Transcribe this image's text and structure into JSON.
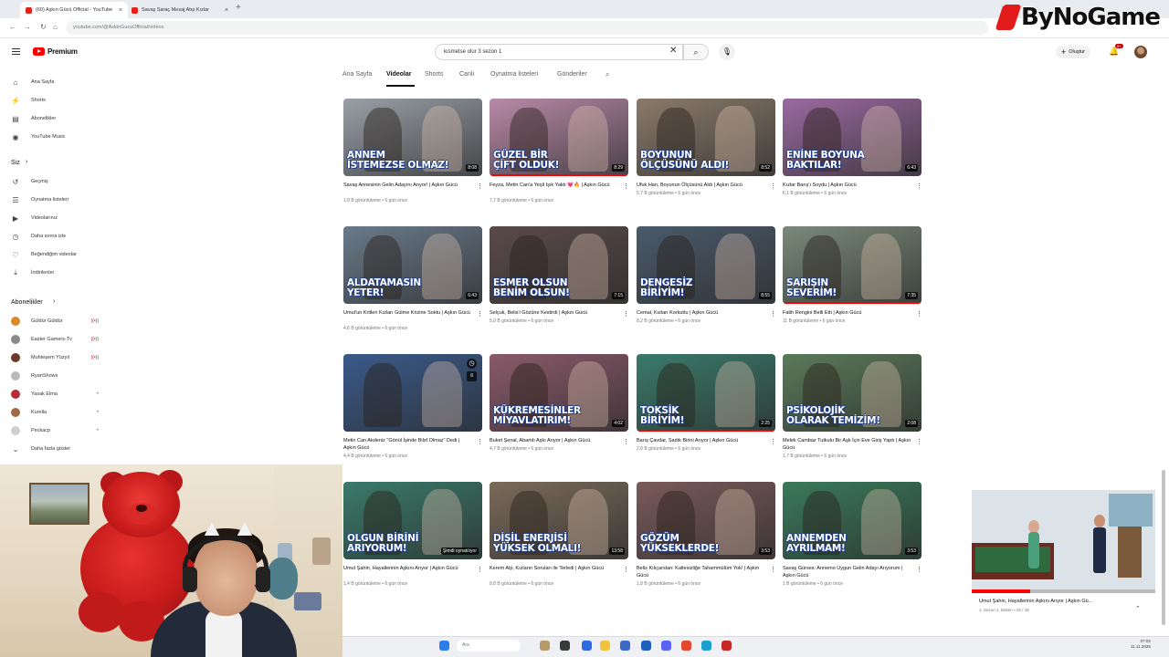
{
  "browser": {
    "tabs": [
      {
        "label": "(60) Aşkın Gücü Official - YouTube"
      },
      {
        "label": "Savaş Saraç Mesaj Atıp Kızlar"
      }
    ],
    "url": "youtube.com/@AskinGucuOfficial/videos"
  },
  "watermark": {
    "text": "ByNoGame"
  },
  "header": {
    "logo_text": "Premium",
    "search_value": "kısmetse olur 3 sezon 1",
    "create_label": "Oluştur",
    "notif_badge": "9+"
  },
  "sidebar": {
    "main": [
      {
        "label": "Ana Sayfa",
        "icon": "home-icon",
        "glyph": "⌂"
      },
      {
        "label": "Shorts",
        "icon": "shorts-icon",
        "glyph": "⚡"
      },
      {
        "label": "Abonelikler",
        "icon": "subscriptions-icon",
        "glyph": "▤"
      },
      {
        "label": "YouTube Music",
        "icon": "music-icon",
        "glyph": "◉"
      }
    ],
    "you_header": "Siz",
    "you": [
      {
        "label": "Geçmiş",
        "icon": "history-icon",
        "glyph": "↺"
      },
      {
        "label": "Oynatma listeleri",
        "icon": "playlists-icon",
        "glyph": "☰"
      },
      {
        "label": "Videolarınız",
        "icon": "your-videos-icon",
        "glyph": "▶"
      },
      {
        "label": "Daha sonra izle",
        "icon": "watch-later-icon",
        "glyph": "◷"
      },
      {
        "label": "Beğendiğim videolar",
        "icon": "liked-icon",
        "glyph": "♡"
      },
      {
        "label": "İndirilenler",
        "icon": "downloads-icon",
        "glyph": "⤓"
      }
    ],
    "subs_header": "Abonelikler",
    "subscriptions": [
      {
        "label": "Güldür Güldür",
        "status": "live",
        "color": "#d88a2a"
      },
      {
        "label": "Easter Gamers-Tv",
        "status": "live",
        "color": "#8a8a8a"
      },
      {
        "label": "Muhteşem Yüzyıl",
        "status": "live",
        "color": "#6a3a2a"
      },
      {
        "label": "RyanShows",
        "status": "",
        "color": "#bbbbbb"
      },
      {
        "label": "Yasak Elma",
        "status": "dot",
        "color": "#b82a3a"
      },
      {
        "label": "Kurella",
        "status": "dot",
        "color": "#a06a4a"
      },
      {
        "label": "Peckacp",
        "status": "dot",
        "color": "#cfcfcf"
      }
    ],
    "show_more": "Daha fazla göster"
  },
  "tabs": [
    "Ana Sayfa",
    "Videolar",
    "Shorts",
    "Canlı",
    "Oynatma listeleri",
    "Gönderiler"
  ],
  "videos": [
    {
      "overlay": [
        "ANNEM",
        "İSTEMEZSE OLMAZ!"
      ],
      "duration": "8:08",
      "title": "Savaş Annesinin Gelin Adayını Arıyor! | Aşkın Gücü",
      "views": "1,8 B görüntüleme",
      "ago": "6 gün önce",
      "progress": 0,
      "bg": "#9aa0a8"
    },
    {
      "overlay": [
        "GÜZEL BİR",
        "ÇİFT OLDUK!"
      ],
      "duration": "8:29",
      "title": "Feyza, Metin Can'a Yeşil Işık Yaktı 💗🔥 | Aşkın Gücü",
      "views": "7,7 B görüntüleme",
      "ago": "6 gün önce",
      "progress": 1,
      "bg": "#b88aa8"
    },
    {
      "overlay": [
        "BOYUNUN",
        "ÖLÇÜSÜNÜ ALDI!"
      ],
      "duration": "8:52",
      "title": "Ufuk Han, Boyunun Ölçüsünü Aldı | Aşkın Gücü",
      "views": "5,7 B görüntüleme",
      "ago": "6 gün önce",
      "progress": 0,
      "bg": "#8a7a6a"
    },
    {
      "overlay": [
        "ENİNE BOYUNA",
        "BAKTILAR!"
      ],
      "duration": "6:43",
      "title": "Kızlar Barış'ı Soydu | Aşkın Gücü",
      "views": "6,1 B görüntüleme",
      "ago": "6 gün önce",
      "progress": 0,
      "bg": "#9a6aa0"
    },
    {
      "overlay": [
        "ALDATAMASIN",
        "YETER!"
      ],
      "duration": "6:43",
      "title": "Umut'un Kritleri Kızları Gülme Krizine Soktu | Aşkın Gücü",
      "views": "4,6 B görüntüleme",
      "ago": "6 gün önce",
      "progress": 0,
      "bg": "#6a7a8a"
    },
    {
      "overlay": [
        "ESMER OLSUN",
        "BENİM OLSUN!"
      ],
      "duration": "7:15",
      "title": "Selçuk, Belis'i Gözüne Kestirdi | Aşkın Gücü",
      "views": "5,9 B görüntüleme",
      "ago": "6 gün önce",
      "progress": 0,
      "bg": "#5a4a4a"
    },
    {
      "overlay": [
        "DENGESİZ",
        "BİRİYİM!"
      ],
      "duration": "8:55",
      "title": "Cemal, Kızları Korkuttu | Aşkın Gücü",
      "views": "8,2 B görüntüleme",
      "ago": "6 gün önce",
      "progress": 0,
      "bg": "#4a5a6a"
    },
    {
      "overlay": [
        "SARIŞIN",
        "SEVERİM!"
      ],
      "duration": "7:35",
      "title": "Fatih Rengini Belli Etti | Aşkın Gücü",
      "views": "11 B görüntüleme",
      "ago": "6 gün önce",
      "progress": 1,
      "bg": "#7a8a7a"
    },
    {
      "overlay": [
        "",
        ""
      ],
      "duration": "",
      "title": "Metin Can Akdeniz \"Gönül İşinde Bilsf Olmaz\" Dedi | Aşkın Gücü",
      "views": "4,4 B görüntüleme",
      "ago": "6 gün önce",
      "progress": 0,
      "bg": "#3a5a8a",
      "watch_later": true
    },
    {
      "overlay": [
        "KÜKREMESİNLER",
        "MİYAVLATIRIM!"
      ],
      "duration": "4:02",
      "title": "Buket Şenal, Abartılı Aşkı Arıyor | Aşkın Gücü",
      "views": "4,7 B görüntüleme",
      "ago": "6 gün önce",
      "progress": 0,
      "bg": "#8a5a6a"
    },
    {
      "overlay": [
        "TOKSİK",
        "BİRİYİM!"
      ],
      "duration": "2:25",
      "title": "Barış Çavdar, Sadık Birini Arıyor | Aşkın Gücü",
      "views": "2,8 B görüntüleme",
      "ago": "6 gün önce",
      "progress": 1,
      "bg": "#3a7a6a"
    },
    {
      "overlay": [
        "PSİKOLOJİK",
        "OLARAK TEMİZİM!"
      ],
      "duration": "2:08",
      "title": "Melek Cambaz Tutkulu Bir Aşk İçin Eve Giriş Yaptı | Aşkın Gücü",
      "views": "1,7 B görüntüleme",
      "ago": "6 gün önce",
      "progress": 0,
      "bg": "#5a7a5a"
    },
    {
      "overlay": [
        "OLGUN BİRİNİ",
        "ARIYORUM!"
      ],
      "duration": "Şimdi oynatılıyor",
      "title": "Umut Şahin, Hayallerinin Aşkını Arıyor | Aşkın Gücü",
      "views": "1,4 B görüntüleme",
      "ago": "6 gün önce",
      "progress": 0,
      "bg": "#3a7a6a"
    },
    {
      "overlay": [
        "DİŞİL ENERJİSİ",
        "YÜKSEK OLMALI!"
      ],
      "duration": "13:58",
      "title": "Kerem Alp, Kızların Soruları ile Terledi | Aşkın Gücü",
      "views": "8,8 B görüntüleme",
      "ago": "6 gün önce",
      "progress": 0,
      "bg": "#7a6a5a"
    },
    {
      "overlay": [
        "GÖZÜM",
        "YÜKSEKLERDE!"
      ],
      "duration": "3:53",
      "title": "Belis Kılıçarslan: Kaltesizliğe Tahammülüm Yok! | Aşkın Gücü",
      "views": "1,8 B görüntüleme",
      "ago": "6 gün önce",
      "progress": 0,
      "bg": "#7a5a5a"
    },
    {
      "overlay": [
        "ANNEMDEN",
        "AYRILMAM!"
      ],
      "duration": "3:53",
      "title": "Savaş Gürses: Annemo Uygun Gelin Adayı Arıyorum | Aşkın Gücü",
      "views": "1 B görüntüleme",
      "ago": "6 gün önce",
      "progress": 0,
      "bg": "#3a7a5a"
    }
  ],
  "mini_player": {
    "title": "Umut Şahin, Hayallerinin Aşkını Arıyor | Aşkın Gü...",
    "subtitle": "1. Sezon 1. Bölüm • 28 / 29"
  },
  "taskbar": {
    "search": "Ara",
    "time": "07:02",
    "date": "11.11.2025"
  }
}
